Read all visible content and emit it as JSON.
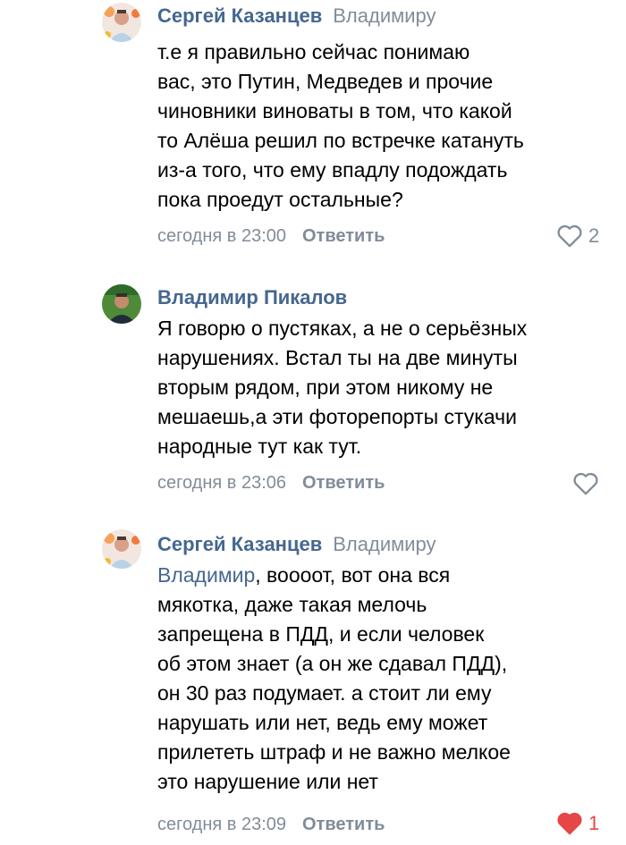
{
  "colors": {
    "author_link": "#45678f",
    "secondary_text": "#818c99",
    "like_active": "#e64646",
    "text": "#000000"
  },
  "comments": [
    {
      "author": "Сергей Казанцев",
      "reply_to": "Владимиру",
      "avatar_icon": "user-avatar-photo",
      "lines": [
        "т.е я правильно сейчас понимаю",
        "вас, это Путин, Медведев и прочие",
        "чиновники виноваты в том, что какой",
        "то Алёша решил по встречке катануть",
        "из-а того, что ему впадлу подождать",
        "пока проедут остальные?"
      ],
      "time": "сегодня в 23:00",
      "reply_label": "Ответить",
      "like_count": "2",
      "liked": false
    },
    {
      "author": "Владимир Пикалов",
      "reply_to": "",
      "avatar_icon": "user-avatar-photo",
      "lines": [
        "Я говорю о пустяках, а не о серьёзных",
        "нарушениях. Встал ты на две минуты",
        "вторым рядом, при этом никому не",
        "мешаешь,а эти фоторепорты стукачи",
        "народные тут как тут."
      ],
      "time": "сегодня в 23:06",
      "reply_label": "Ответить",
      "like_count": "",
      "liked": false
    },
    {
      "author": "Сергей Казанцев",
      "reply_to": "Владимиру",
      "avatar_icon": "user-avatar-photo",
      "mention": "Владимир",
      "first_line_rest": ", воооот, вот она вся",
      "lines": [
        "мякотка, даже такая мелочь",
        "запрещена в ПДД, и если человек",
        "об этом знает (а он же сдавал ПДД),",
        "он 30 раз подумает. а стоит ли ему",
        "нарушать или нет, ведь ему может",
        "прилететь штраф и не важно мелкое",
        "это нарушение или нет"
      ],
      "time": "сегодня в 23:09",
      "reply_label": "Ответить",
      "like_count": "1",
      "liked": true
    }
  ]
}
